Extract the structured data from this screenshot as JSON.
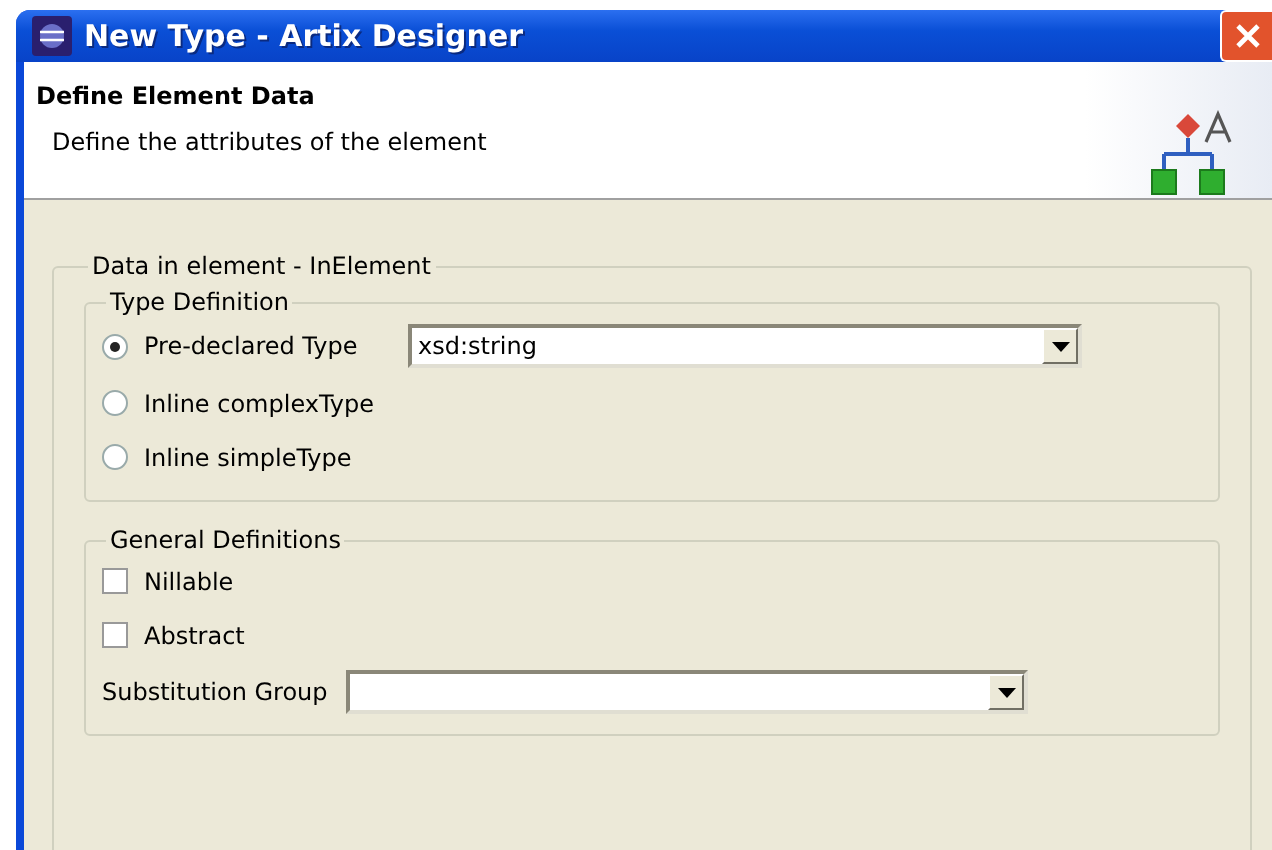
{
  "window": {
    "title": "New Type - Artix Designer"
  },
  "header": {
    "title": "Define Element Data",
    "description": "Define the attributes of the element"
  },
  "group": {
    "legend": "Data in element - InElement",
    "type_definition": {
      "legend": "Type Definition",
      "options": [
        {
          "label": "Pre-declared Type",
          "selected": true,
          "combo": "xsd:string"
        },
        {
          "label": "Inline complexType",
          "selected": false
        },
        {
          "label": "Inline simpleType",
          "selected": false
        }
      ]
    },
    "general_definitions": {
      "legend": "General Definitions",
      "checkboxes": [
        {
          "label": "Nillable",
          "checked": false
        },
        {
          "label": "Abstract",
          "checked": false
        }
      ],
      "substitution_group": {
        "label": "Substitution Group"
      }
    }
  }
}
